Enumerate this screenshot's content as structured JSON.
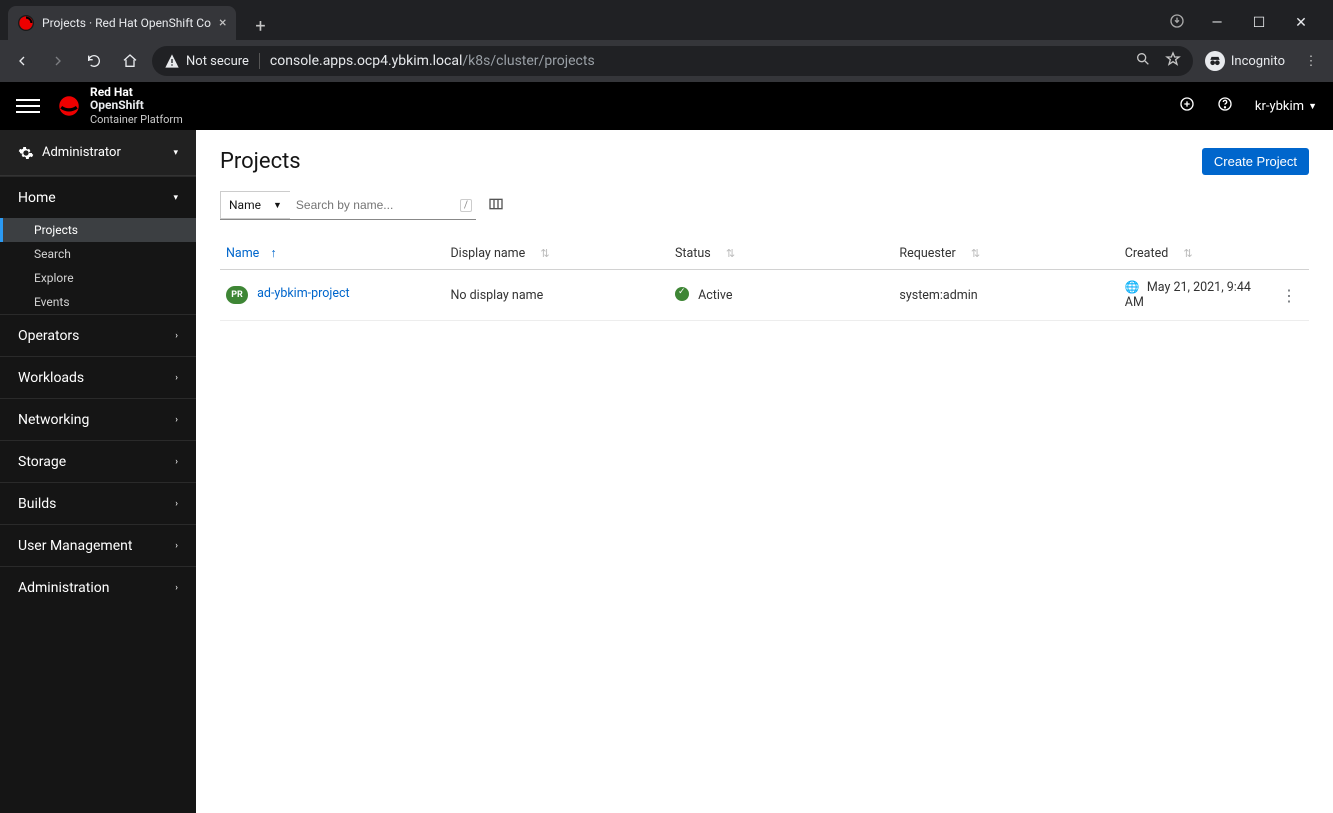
{
  "browser": {
    "tab_title": "Projects · Red Hat OpenShift Co",
    "not_secure": "Not secure",
    "url_host": "console.apps.ocp4.ybkim.local",
    "url_path": "/k8s/cluster/projects",
    "incognito": "Incognito"
  },
  "masthead": {
    "brand_line1": "Red Hat",
    "brand_line2_a": "OpenShift",
    "brand_line2_b": "Container Platform",
    "user": "kr-ybkim"
  },
  "sidebar": {
    "perspective": "Administrator",
    "groups": {
      "home": "Home",
      "operators": "Operators",
      "workloads": "Workloads",
      "networking": "Networking",
      "storage": "Storage",
      "builds": "Builds",
      "user_mgmt": "User Management",
      "administration": "Administration"
    },
    "home_items": [
      "Projects",
      "Search",
      "Explore",
      "Events"
    ]
  },
  "page": {
    "title": "Projects",
    "create_btn": "Create Project",
    "filter_field": "Name",
    "search_placeholder": "Search by name...",
    "columns": {
      "name": "Name",
      "display": "Display name",
      "status": "Status",
      "requester": "Requester",
      "created": "Created"
    },
    "badge_text": "PR",
    "rows": [
      {
        "name": "ad-ybkim-project",
        "display": "No display name",
        "status": "Active",
        "requester": "system:admin",
        "created": "May 21, 2021, 9:44 AM"
      }
    ]
  }
}
